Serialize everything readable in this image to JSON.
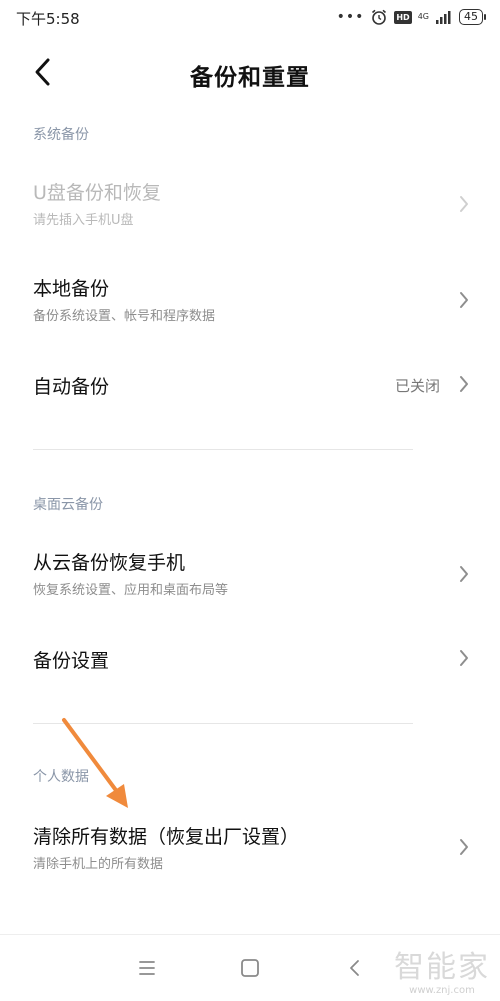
{
  "status_bar": {
    "time": "下午5:58",
    "dots": "•••",
    "hd": "HD",
    "network": "4G",
    "battery": "45"
  },
  "header": {
    "title": "备份和重置"
  },
  "sections": [
    {
      "title": "系统备份",
      "items": [
        {
          "title": "U盘备份和恢复",
          "subtitle": "请先插入手机U盘",
          "enabled": false
        },
        {
          "title": "本地备份",
          "subtitle": "备份系统设置、帐号和程序数据",
          "enabled": true
        },
        {
          "title": "自动备份",
          "value": "已关闭",
          "enabled": true
        }
      ]
    },
    {
      "title": "桌面云备份",
      "items": [
        {
          "title": "从云备份恢复手机",
          "subtitle": "恢复系统设置、应用和桌面布局等",
          "enabled": true
        },
        {
          "title": "备份设置",
          "enabled": true
        }
      ]
    },
    {
      "title": "个人数据",
      "items": [
        {
          "title": "清除所有数据（恢复出厂设置）",
          "subtitle": "清除手机上的所有数据",
          "enabled": true
        }
      ]
    }
  ],
  "watermark": {
    "title": "智能家",
    "url": "www.znj.com"
  },
  "colors": {
    "annotation_arrow": "#f08a3c",
    "section_title": "#8a96a8",
    "chevron": "#9a9a9a"
  },
  "icons": [
    "back-icon",
    "chevron-right-icon",
    "menu-icon",
    "home-icon",
    "nav-back-icon",
    "alarm-icon",
    "signal-icon"
  ]
}
